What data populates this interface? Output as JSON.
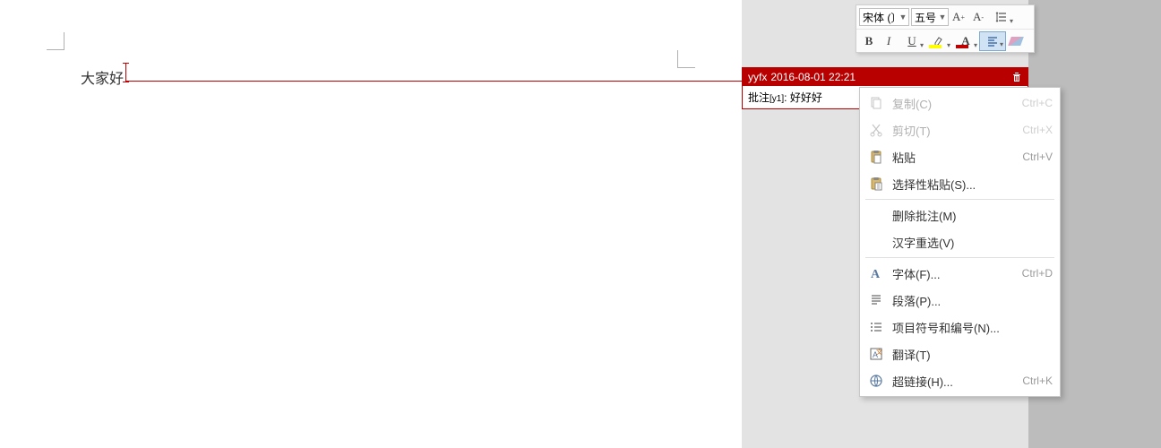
{
  "document": {
    "text": "大家好"
  },
  "comment": {
    "author": "yyfx",
    "datetime": "2016-08-01 22:21",
    "prefix": "批注",
    "ref": "[y1]",
    "sep": ": ",
    "text": "好好好"
  },
  "toolbar": {
    "font_name": "宋体 (〕",
    "font_size": "五号"
  },
  "context_menu": {
    "items": [
      {
        "icon": "copy",
        "label": "复制(C)",
        "shortcut": "Ctrl+C",
        "enabled": false
      },
      {
        "icon": "cut",
        "label": "剪切(T)",
        "shortcut": "Ctrl+X",
        "enabled": false
      },
      {
        "icon": "paste",
        "label": "粘贴",
        "shortcut": "Ctrl+V",
        "enabled": true
      },
      {
        "icon": "pastesp",
        "label": "选择性粘贴(S)...",
        "shortcut": "",
        "enabled": true
      },
      {
        "sep": true
      },
      {
        "icon": "",
        "label": "删除批注(M)",
        "shortcut": "",
        "enabled": true
      },
      {
        "icon": "",
        "label": "汉字重选(V)",
        "shortcut": "",
        "enabled": true
      },
      {
        "sep": true
      },
      {
        "icon": "font",
        "label": "字体(F)...",
        "shortcut": "Ctrl+D",
        "enabled": true
      },
      {
        "icon": "para",
        "label": "段落(P)...",
        "shortcut": "",
        "enabled": true
      },
      {
        "icon": "bullets",
        "label": "项目符号和编号(N)...",
        "shortcut": "",
        "enabled": true
      },
      {
        "icon": "translate",
        "label": "翻译(T)",
        "shortcut": "",
        "enabled": true
      },
      {
        "icon": "link",
        "label": "超链接(H)...",
        "shortcut": "Ctrl+K",
        "enabled": true
      }
    ]
  }
}
